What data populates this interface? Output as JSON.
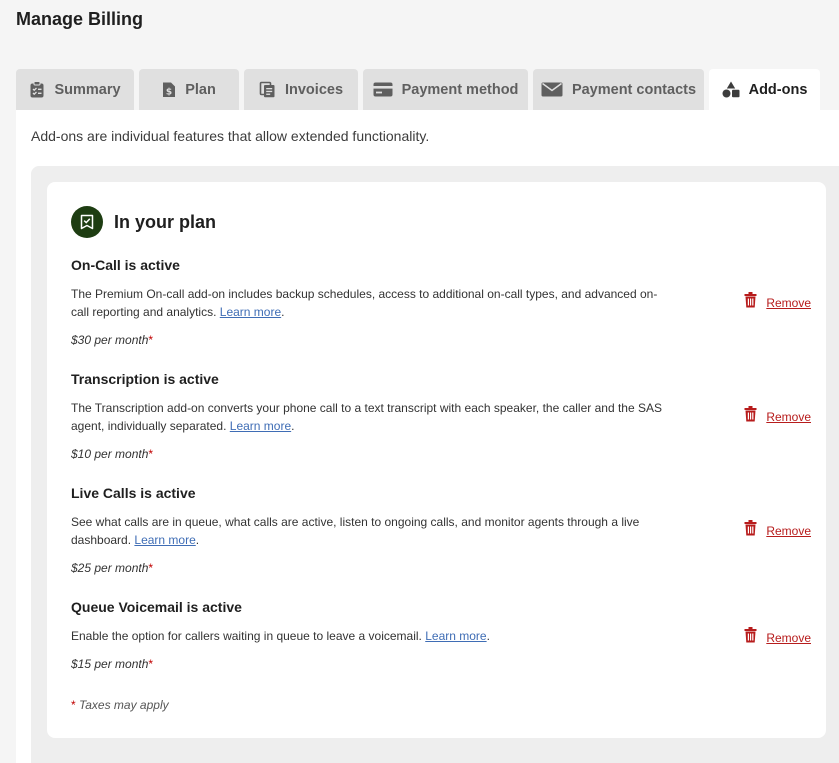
{
  "page": {
    "title": "Manage Billing"
  },
  "tabs": [
    {
      "label": "Summary",
      "icon": "clipboard-icon",
      "active": false
    },
    {
      "label": "Plan",
      "icon": "document-dollar-icon",
      "active": false
    },
    {
      "label": "Invoices",
      "icon": "copy-documents-icon",
      "active": false
    },
    {
      "label": "Payment method",
      "icon": "credit-card-icon",
      "active": false
    },
    {
      "label": "Payment contacts",
      "icon": "envelope-icon",
      "active": false
    },
    {
      "label": "Add-ons",
      "icon": "shapes-icon",
      "active": true
    }
  ],
  "intro": "Add-ons are individual features that allow extended functionality.",
  "plan_card": {
    "title": "In your plan",
    "badge_color": "#1e3d12",
    "addons": [
      {
        "name": "On-Call is active",
        "description": "The Premium On-call add-on includes backup schedules, access to additional on-call types, and advanced on-call reporting and analytics.",
        "learn_more": "Learn more",
        "suffix": ".",
        "price": "$30 per month",
        "required_mark": "*",
        "remove_label": "Remove"
      },
      {
        "name": "Transcription is active",
        "description": "The Transcription add-on converts your phone call to a text transcript with each speaker, the caller and the SAS agent, individually separated.",
        "learn_more": "Learn more",
        "suffix": ".",
        "price": "$10 per month",
        "required_mark": "*",
        "remove_label": "Remove"
      },
      {
        "name": "Live Calls is active",
        "description": "See what calls are in queue, what calls are active, listen to ongoing calls, and monitor agents through a live dashboard.",
        "learn_more": "Learn more",
        "suffix": ".",
        "price": "$25 per month",
        "required_mark": "*",
        "remove_label": "Remove"
      },
      {
        "name": "Queue Voicemail is active",
        "description": "Enable the option for callers waiting in queue to leave a voicemail.",
        "learn_more": "Learn more",
        "suffix": ".",
        "price": "$15 per month",
        "required_mark": "*",
        "remove_label": "Remove"
      }
    ],
    "footnote_mark": "*",
    "footnote": "Taxes may apply"
  },
  "colors": {
    "accent_remove": "#b71c1c",
    "link": "#3f6db5",
    "badge": "#1e3d12"
  }
}
